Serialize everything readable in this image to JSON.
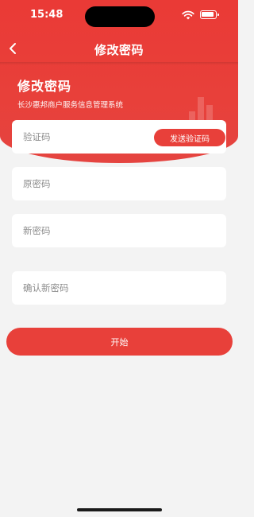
{
  "status_bar": {
    "time": "15:48"
  },
  "nav": {
    "title": "修改密码",
    "back_icon": "chevron-left-icon"
  },
  "hero": {
    "title": "修改密码",
    "subtitle": "长沙惠邦商户服务信息管理系统"
  },
  "form": {
    "verification_code": {
      "placeholder": "验证码",
      "value": ""
    },
    "send_code_label": "发送验证码",
    "old_password": {
      "placeholder": "原密码",
      "value": ""
    },
    "new_password": {
      "placeholder": "新密码",
      "value": ""
    },
    "confirm_password": {
      "placeholder": "确认新密码",
      "value": ""
    }
  },
  "actions": {
    "start_label": "开始"
  },
  "colors": {
    "accent": "#e8403a",
    "background": "#f3f3f3"
  }
}
